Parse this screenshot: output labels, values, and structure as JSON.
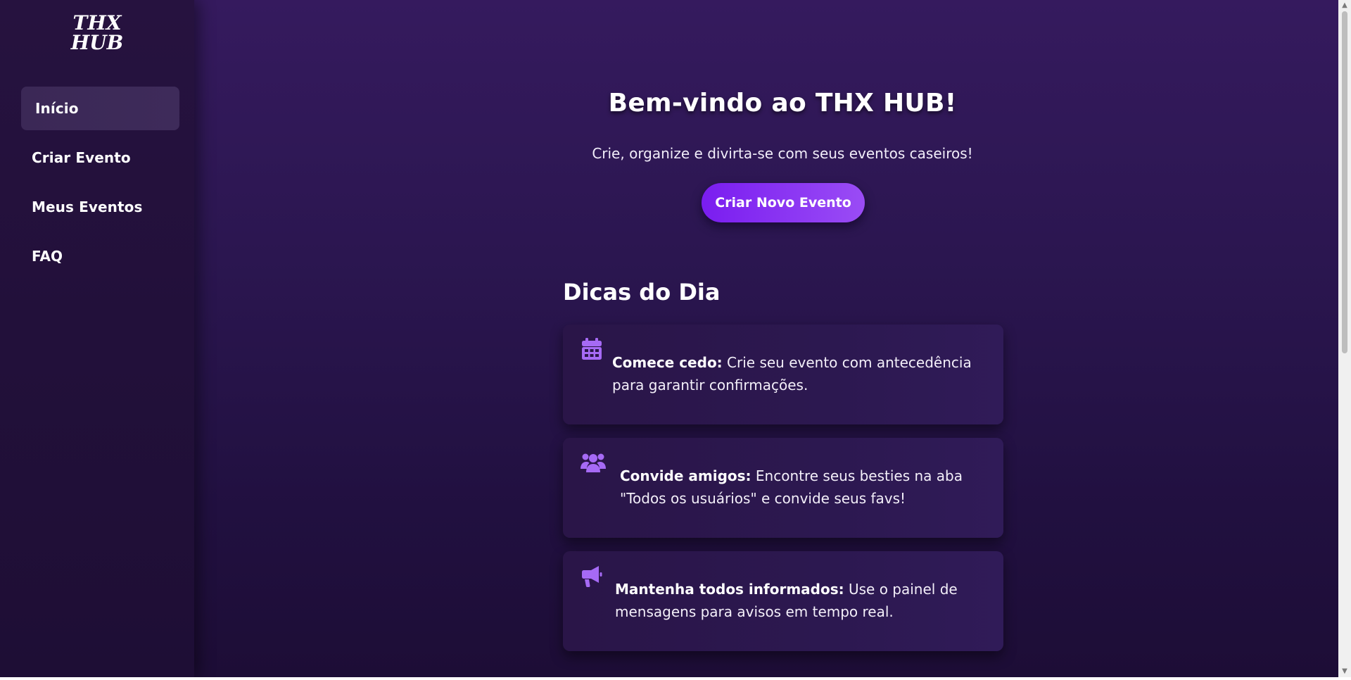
{
  "sidebar": {
    "logo_text_line1": "THX",
    "logo_text_line2": "HUB",
    "items": [
      {
        "label": "Início",
        "active": true
      },
      {
        "label": "Criar Evento",
        "active": false
      },
      {
        "label": "Meus Eventos",
        "active": false
      },
      {
        "label": "FAQ",
        "active": false
      }
    ]
  },
  "main": {
    "title": "Bem-vindo ao THX HUB!",
    "subtitle": "Crie, organize e divirta-se com seus eventos caseiros!",
    "cta_label": "Criar Novo Evento",
    "tips_title": "Dicas do Dia",
    "tips": [
      {
        "icon": "calendar-icon",
        "heading": "Comece cedo:",
        "line1": " Crie seu evento com antecedência",
        "line2": "para garantir confirmações."
      },
      {
        "icon": "users-icon",
        "heading": "Convide amigos:",
        "line1": " Encontre seus besties na aba",
        "line2": "\"Todos os usuários\" e convide seus favs!"
      },
      {
        "icon": "megaphone-icon",
        "heading": "Mantenha todos informados:",
        "line1": " Use o painel de",
        "line2": "mensagens para avisos em tempo real."
      }
    ]
  },
  "colors": {
    "accent": "#8a3cf3",
    "icon": "#a66af5",
    "background": "#2b1650"
  }
}
